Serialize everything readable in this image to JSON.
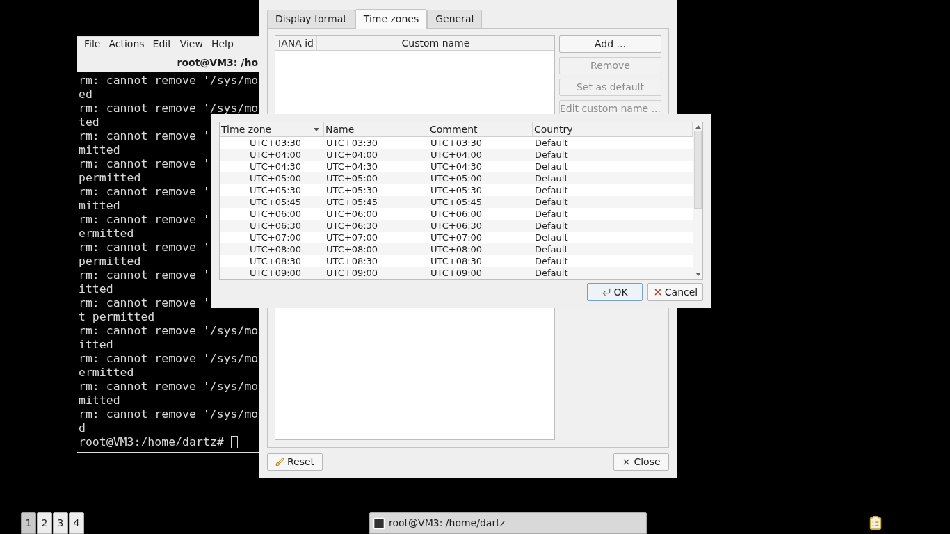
{
  "terminal": {
    "menu": [
      "File",
      "Actions",
      "Edit",
      "View",
      "Help"
    ],
    "title": "root@VM3: /ho",
    "lines": [
      "rm: cannot remove '/sys/mo",
      "ed",
      "rm: cannot remove '/sys/mo",
      "ted",
      "rm: cannot remove '",
      "mitted",
      "rm: cannot remove '",
      "permitted",
      "rm: cannot remove '",
      "mitted",
      "rm: cannot remove '",
      "ermitted",
      "rm: cannot remove '",
      "permitted",
      "rm: cannot remove '",
      "itted",
      "rm: cannot remove '",
      "t permitted",
      "rm: cannot remove '/sys/mo",
      "itted",
      "rm: cannot remove '/sys/mo",
      "ermitted",
      "rm: cannot remove '/sys/mo",
      "mitted",
      "rm: cannot remove '/sys/mo",
      "d"
    ],
    "prompt": "root@VM3:/home/dartz#"
  },
  "dialog": {
    "tabs": [
      {
        "label": "Display format",
        "selected": false
      },
      {
        "label": "Time zones",
        "selected": true
      },
      {
        "label": "General",
        "selected": false
      }
    ],
    "table": {
      "columns": [
        "IANA id",
        "Custom name"
      ]
    },
    "buttons": [
      {
        "label": "Add ...",
        "disabled": false
      },
      {
        "label": "Remove",
        "disabled": true
      },
      {
        "label": "Set as default",
        "disabled": true
      },
      {
        "label": "Edit custom name ...",
        "disabled": true
      }
    ],
    "reset": "Reset",
    "close": "Close"
  },
  "picker": {
    "columns": [
      {
        "label": "Time zone",
        "sorted": true
      },
      {
        "label": "Name",
        "sorted": false
      },
      {
        "label": "Comment",
        "sorted": false
      },
      {
        "label": "Country",
        "sorted": false
      }
    ],
    "rows": [
      [
        "UTC+03:30",
        "UTC+03:30",
        "UTC+03:30",
        "Default"
      ],
      [
        "UTC+04:00",
        "UTC+04:00",
        "UTC+04:00",
        "Default"
      ],
      [
        "UTC+04:30",
        "UTC+04:30",
        "UTC+04:30",
        "Default"
      ],
      [
        "UTC+05:00",
        "UTC+05:00",
        "UTC+05:00",
        "Default"
      ],
      [
        "UTC+05:30",
        "UTC+05:30",
        "UTC+05:30",
        "Default"
      ],
      [
        "UTC+05:45",
        "UTC+05:45",
        "UTC+05:45",
        "Default"
      ],
      [
        "UTC+06:00",
        "UTC+06:00",
        "UTC+06:00",
        "Default"
      ],
      [
        "UTC+06:30",
        "UTC+06:30",
        "UTC+06:30",
        "Default"
      ],
      [
        "UTC+07:00",
        "UTC+07:00",
        "UTC+07:00",
        "Default"
      ],
      [
        "UTC+08:00",
        "UTC+08:00",
        "UTC+08:00",
        "Default"
      ],
      [
        "UTC+08:30",
        "UTC+08:30",
        "UTC+08:30",
        "Default"
      ],
      [
        "UTC+09:00",
        "UTC+09:00",
        "UTC+09:00",
        "Default"
      ]
    ],
    "ok": "OK",
    "cancel": "Cancel"
  },
  "taskbar": {
    "desktops": [
      {
        "label": "1",
        "selected": true
      },
      {
        "label": "2",
        "selected": false
      },
      {
        "label": "3",
        "selected": false
      },
      {
        "label": "4",
        "selected": false
      }
    ],
    "task": "root@VM3: /home/dartz"
  }
}
